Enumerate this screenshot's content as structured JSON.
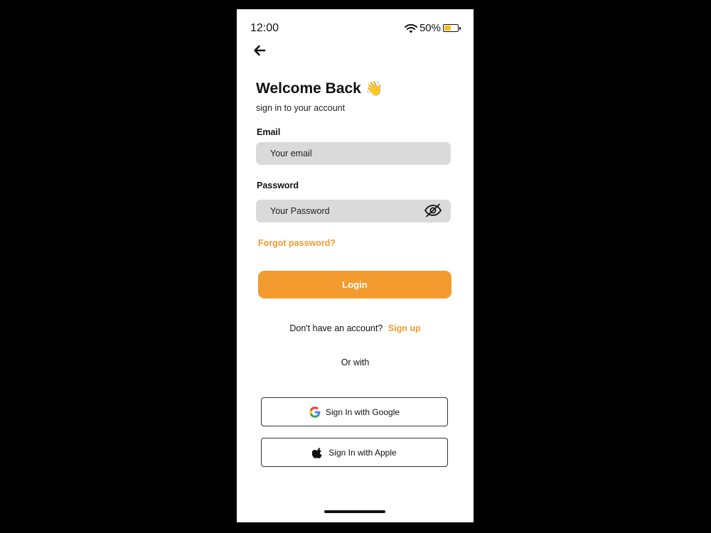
{
  "status_bar": {
    "time": "12:00",
    "battery_text": "50%",
    "battery_level": 0.5
  },
  "header": {
    "title": "Welcome Back",
    "wave_emoji": "👋",
    "subtitle": "sign in to your account"
  },
  "form": {
    "email_label": "Email",
    "email_placeholder": "Your email",
    "password_label": "Password",
    "password_placeholder": "Your Password",
    "forgot_label": "Forgot password?",
    "login_label": "Login"
  },
  "signup": {
    "prompt": "Don't have an account?",
    "link": "Sign up"
  },
  "social": {
    "divider": "Or with",
    "google_label": "Sign In with Google",
    "apple_label": "Sign In with Apple"
  },
  "colors": {
    "accent": "#f39b2e",
    "input_bg": "#dadada",
    "battery_fill": "#f2c21b"
  },
  "icons": [
    "wifi-icon",
    "battery-icon",
    "back-arrow-icon",
    "eye-off-icon",
    "google-icon",
    "apple-icon"
  ]
}
